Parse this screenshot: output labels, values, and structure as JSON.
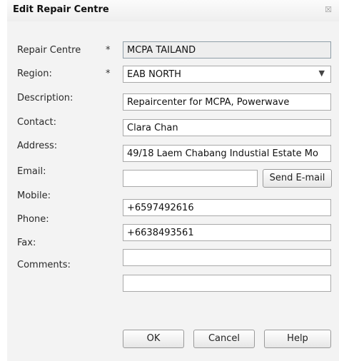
{
  "dialog": {
    "title": "Edit Repair Centre",
    "close_glyph": "☒"
  },
  "form": {
    "required_mark": "*",
    "repair_centre": {
      "label": "Repair Centre",
      "value": "MCPA TAILAND"
    },
    "region": {
      "label": "Region:",
      "value": "EAB NORTH"
    },
    "description": {
      "label": "Description:",
      "value": "Repaircenter for MCPA, Powerwave"
    },
    "contact": {
      "label": "Contact:",
      "value": "Clara Chan"
    },
    "address": {
      "label": "Address:",
      "value": "49/18 Laem Chabang Industial Estate Mo"
    },
    "email": {
      "label": "Email:",
      "value": "",
      "send_label": "Send E-mail"
    },
    "mobile": {
      "label": "Mobile:",
      "value": "+6597492616"
    },
    "phone": {
      "label": "Phone:",
      "value": "+6638493561"
    },
    "fax": {
      "label": "Fax:",
      "value": ""
    },
    "comments": {
      "label": "Comments:",
      "value": ""
    }
  },
  "buttons": {
    "ok": "OK",
    "cancel": "Cancel",
    "help": "Help"
  },
  "icons": {
    "dropdown": "chevron-down-icon",
    "close": "close-icon"
  }
}
